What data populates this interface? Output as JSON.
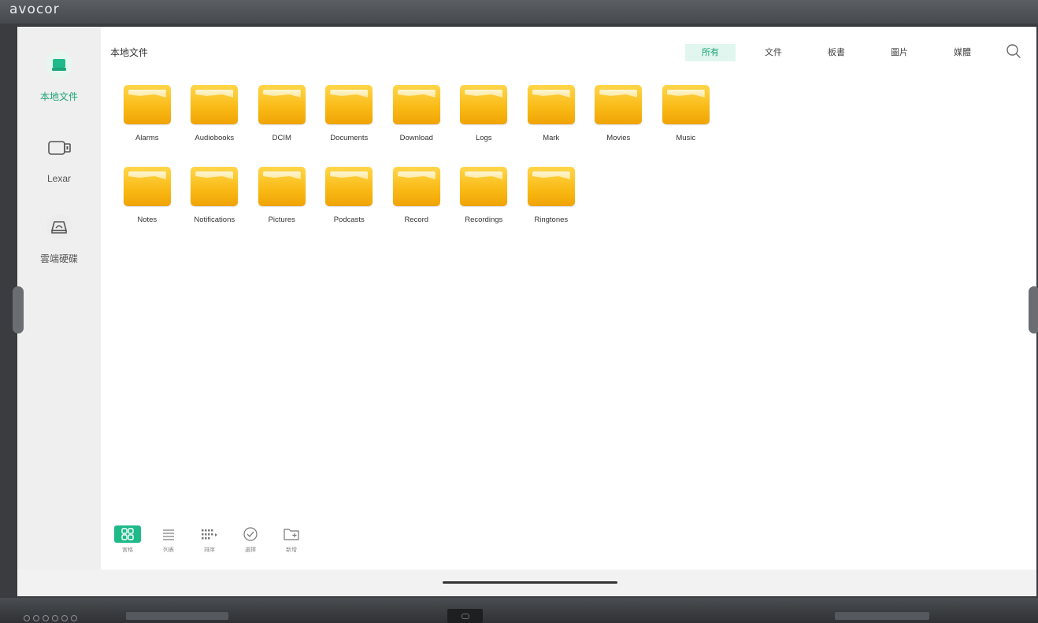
{
  "bezel": {
    "brand": "avocor"
  },
  "sidebar": {
    "items": [
      {
        "label": "本地文件",
        "icon": "drive-icon",
        "active": true
      },
      {
        "label": "Lexar",
        "icon": "usb-drive-icon",
        "active": false
      },
      {
        "label": "雲端硬碟",
        "icon": "cloud-drive-icon",
        "active": false
      }
    ]
  },
  "header": {
    "title": "本地文件",
    "filters": [
      "所有",
      "文件",
      "板書",
      "圖片",
      "媒體"
    ],
    "active_filter": "所有",
    "search_icon": "search-icon"
  },
  "folders": {
    "row1": [
      "Alarms",
      "Audiobooks",
      "DCIM",
      "Documents",
      "Download",
      "Logs",
      "Mark",
      "Movies",
      "Music"
    ],
    "row2": [
      "Notes",
      "Notifications",
      "Pictures",
      "Podcasts",
      "Record",
      "Recordings",
      "Ringtones"
    ]
  },
  "toolbar": {
    "items": [
      {
        "label": "宮格",
        "icon": "grid-view-icon",
        "active": true
      },
      {
        "label": "列表",
        "icon": "list-view-icon",
        "active": false
      },
      {
        "label": "排序",
        "icon": "sort-icon",
        "active": false
      },
      {
        "label": "選擇",
        "icon": "select-icon",
        "active": false
      },
      {
        "label": "新增",
        "icon": "new-folder-icon",
        "active": false
      }
    ]
  },
  "colors": {
    "accent": "#1aa478",
    "folder": "#f9b914",
    "active_tab_bg": "#e1f6ee"
  }
}
